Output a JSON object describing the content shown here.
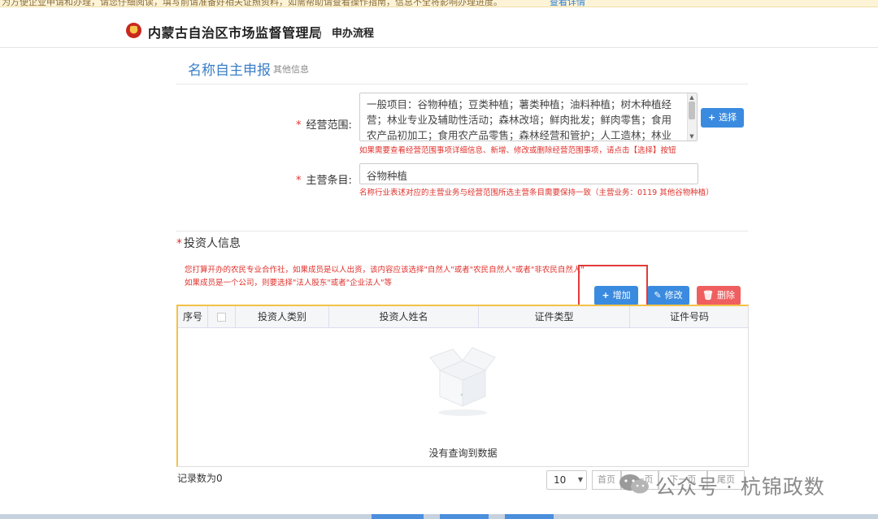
{
  "notice": {
    "text": "为方便企业申请和办理，请您仔细阅读，填写前请准备好相关证照资料，如需帮助请查看操作指南，信息不全将影响办理进度。",
    "link": "查看详情"
  },
  "header": {
    "site_title": "内蒙古自治区市场监督管理局",
    "process_title": "申办流程"
  },
  "form": {
    "title": "名称自主申报",
    "subtitle": "其他信息",
    "business_scope": {
      "label": "经营范围:",
      "required_mark": "*",
      "value": "一般项目：谷物种植；豆类种植；薯类种植；油料种植；树木种植经营；林业专业及辅助性活动；森林改培；鲜肉批发；鲜肉零售；食用农产品初加工；食用农产品零售；森林经营和管护；人工造林；林业有害生物防治服务；林业机械服务；农林牧副渔业专业机械的安装、维修",
      "select_button": "选择",
      "hint": "如果需要查看经营范围事项详细信息、新增、修改或删除经营范围事项，请点击【选择】按钮"
    },
    "main_item": {
      "label": "主营条目:",
      "required_mark": "*",
      "value": "谷物种植",
      "hint": "名称行业表述对应的主营业务与经营范围所选主营条目需要保持一致（主营业务：0119 其他谷物种植）"
    }
  },
  "investor": {
    "title": "投资人信息",
    "required_mark": "*",
    "hint_line1": "您打算开办的农民专业合作社，如果成员是以人出资，该内容应该选择\"自然人\"或者\"农民自然人\"或者\"非农民自然人\"",
    "hint_line2": "如果成员是一个公司，则要选择\"法人股东\"或者\"企业法人\"等",
    "add_button": "增加",
    "edit_button": "修改",
    "delete_button": "删除",
    "columns": [
      "序号",
      "",
      "投资人类别",
      "投资人姓名",
      "证件类型",
      "证件号码"
    ],
    "empty_text": "没有查询到数据",
    "record_count": "记录数为0",
    "page_size": "10",
    "pager_first": "首页",
    "pager_prev": "上一页",
    "pager_next": "下一页",
    "pager_last": "尾页"
  },
  "watermark": "公众号 · 杭锦政数",
  "colors": {
    "accent": "#3a8be0",
    "danger": "#e0312c",
    "title_blue": "#3a7fc6",
    "grid_border": "#f3c247"
  }
}
